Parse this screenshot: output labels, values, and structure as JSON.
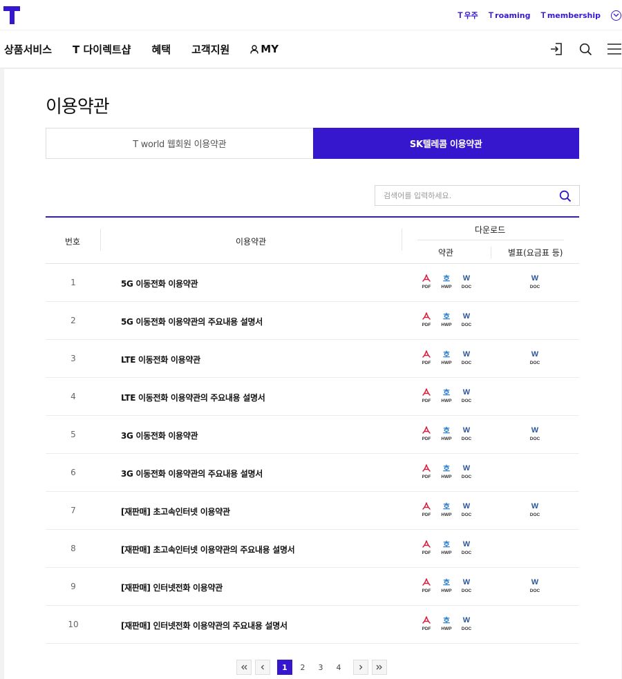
{
  "header": {
    "logo_alt": "T",
    "utility_links": [
      {
        "label": "우주",
        "mark": "T"
      },
      {
        "label": "roaming",
        "mark": "T"
      },
      {
        "label": "membership",
        "mark": "T"
      }
    ],
    "gnb": [
      "상품서비스",
      "T 다이렉트샵",
      "혜택",
      "고객지원",
      "MY"
    ],
    "icons": [
      "login-icon",
      "search-icon",
      "menu-icon"
    ]
  },
  "page": {
    "title": "이용약관",
    "tabs": [
      {
        "label": "T world 웹회원 이용약관",
        "active": false
      },
      {
        "label": "SK텔레콤 이용약관",
        "active": true
      }
    ],
    "search": {
      "placeholder": "검색어를 입력하세요."
    }
  },
  "table": {
    "headers": {
      "no": "번호",
      "name": "이용약관",
      "download": "다운로드",
      "terms": "약관",
      "attachment": "별표(요금표 등)"
    },
    "file_labels": {
      "pdf": "PDF",
      "hwp": "HWP",
      "doc": "DOC"
    },
    "rows": [
      {
        "no": "1",
        "name": "5G 이동전화 이용약관",
        "attachment": true
      },
      {
        "no": "2",
        "name": "5G 이동전화 이용약관의 주요내용 설명서",
        "attachment": false
      },
      {
        "no": "3",
        "name": "LTE 이동전화 이용약관",
        "attachment": true
      },
      {
        "no": "4",
        "name": "LTE 이동전화 이용약관의 주요내용 설명서",
        "attachment": false
      },
      {
        "no": "5",
        "name": "3G 이동전화 이용약관",
        "attachment": true
      },
      {
        "no": "6",
        "name": "3G 이동전화 이용약관의 주요내용 설명서",
        "attachment": false
      },
      {
        "no": "7",
        "name": "[재판매] 초고속인터넷 이용약관",
        "attachment": true
      },
      {
        "no": "8",
        "name": "[재판매] 초고속인터넷 이용약관의 주요내용 설명서",
        "attachment": false
      },
      {
        "no": "9",
        "name": "[재판매] 인터넷전화 이용약관",
        "attachment": true
      },
      {
        "no": "10",
        "name": "[재판매] 인터넷전화 이용약관의 주요내용 설명서",
        "attachment": false
      }
    ]
  },
  "pagination": {
    "pages": [
      "1",
      "2",
      "3",
      "4"
    ],
    "current": "1"
  },
  "colors": {
    "brand": "#3617ce",
    "pdf": "#d61c3a",
    "hwp": "#2a7fd0",
    "doc": "#2b579a"
  }
}
